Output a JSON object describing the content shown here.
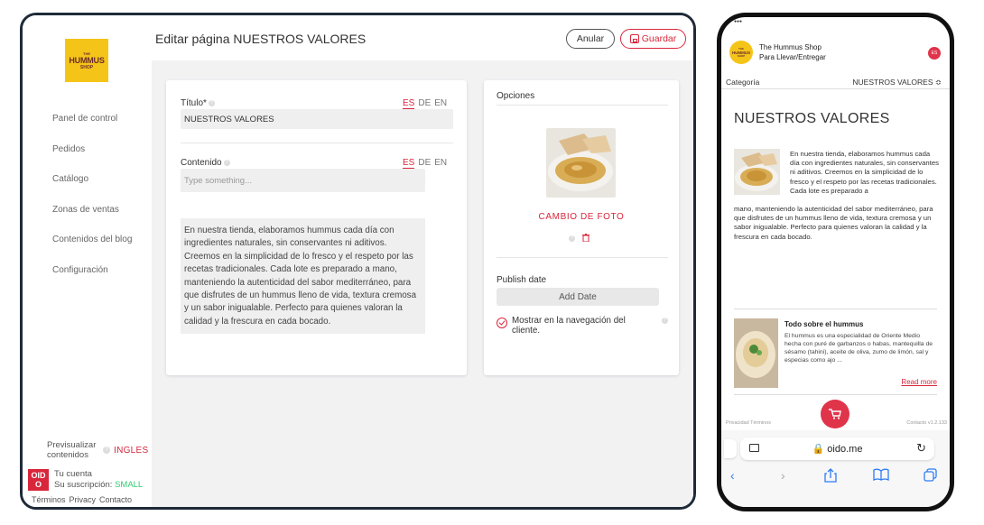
{
  "admin": {
    "logo": {
      "line1": "THE",
      "line2": "HUMMUS",
      "line3": "SHOP"
    },
    "nav": [
      {
        "label": "Panel de control"
      },
      {
        "label": "Pedidos"
      },
      {
        "label": "Catálogo"
      },
      {
        "label": "Zonas de ventas"
      },
      {
        "label": "Contenidos del blog"
      },
      {
        "label": "Configuración"
      }
    ],
    "preview": {
      "label": "Previsualizar contenidos",
      "lang": "INGLES"
    },
    "account": {
      "logo": "OID O",
      "line1": "Tu cuenta",
      "subscription_label": "Su suscripción:",
      "plan": "SMALL"
    },
    "footer": {
      "terms": "Términos",
      "privacy": "Privacy",
      "contact": "Contacto"
    },
    "page_title": "Editar página NUESTROS VALORES",
    "buttons": {
      "cancel": "Anular",
      "save": "Guardar"
    },
    "form": {
      "title_label": "Título*",
      "title_value": "NUESTROS VALORES",
      "content_label": "Contenido",
      "content_placeholder": "Type something...",
      "langs": [
        "ES",
        "DE",
        "EN"
      ],
      "body": "En nuestra tienda, elaboramos hummus cada día con ingredientes naturales, sin conservantes ni aditivos. Creemos en la simplicidad de lo fresco y el respeto por las recetas tradicionales. Cada lote es preparado a mano, manteniendo la autenticidad del sabor mediterráneo, para que disfrutes de un hummus lleno de vida, textura cremosa y un sabor inigualable. Perfecto para quienes valoran la calidad y la frescura en cada bocado."
    },
    "options": {
      "title": "Opciones",
      "change_photo": "CAMBIO DE FOTO",
      "publish_label": "Publish date",
      "add_date": "Add Date",
      "show_nav": "Mostrar en la navegación del cliente."
    }
  },
  "phone": {
    "shop_name": "The Hummus Shop",
    "shop_sub": "Para Llevar/Entregar",
    "lang_badge": "ES",
    "category_label": "Categoría",
    "category_value": "NUESTROS VALORES ≎",
    "page_title": "NUESTROS VALORES",
    "text_top": "En nuestra tienda, elaboramos hummus cada día con ingredientes naturales, sin conservantes ni aditivos. Creemos en la simplicidad de lo fresco y el respeto por las recetas tradicionales. Cada lote es preparado a",
    "text_bottom": "mano, manteniendo la autenticidad del sabor mediterráneo, para que disfrutes de un hummus lleno de vida, textura cremosa y un sabor inigualable. Perfecto para quienes valoran la calidad y la frescura en cada bocado.",
    "blog_title": "Todo sobre el hummus",
    "blog_text": "El hummus es una especialidad de Oriente Medio hecha con puré de garbanzos o habas, mantequilla de sésamo (tahini), aceite de oliva, zumo de limón, sal y especias como ajo ...",
    "read_more": "Read more",
    "footer_left": "Privacidad  Términos",
    "footer_right": "Contacto  v1.2.133",
    "url": "🔒 oido.me"
  },
  "colors": {
    "accent": "#d8263b",
    "logo_yellow": "#f5c418",
    "ios_blue": "#2f7bf6",
    "plan_green": "#2ecc71"
  }
}
